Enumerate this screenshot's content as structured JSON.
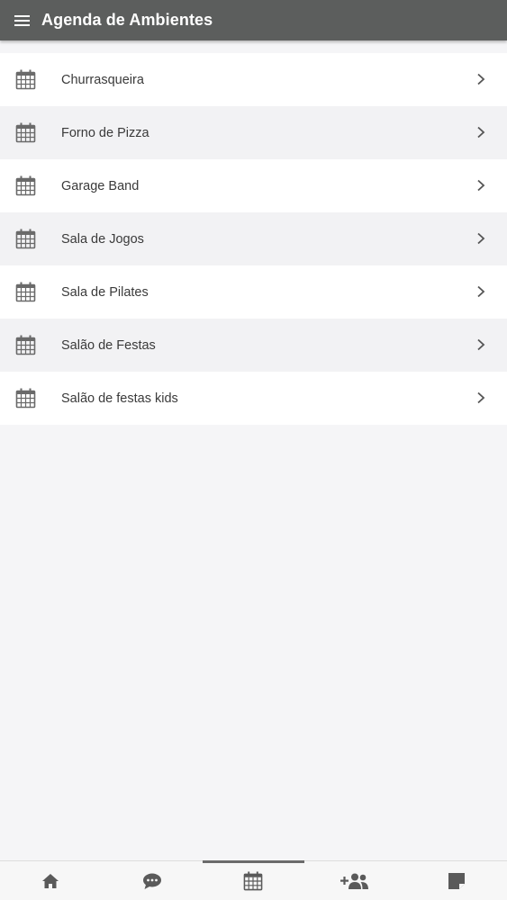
{
  "header": {
    "title": "Agenda de Ambientes",
    "menu_icon": "hamburger-menu-icon",
    "background": "#5c5e5d"
  },
  "list": {
    "item_icon": "calendar-icon",
    "trailing_icon": "chevron-right-icon",
    "items": [
      {
        "label": "Churrasqueira"
      },
      {
        "label": "Forno de Pizza"
      },
      {
        "label": "Garage Band"
      },
      {
        "label": "Sala de Jogos"
      },
      {
        "label": "Sala de Pilates"
      },
      {
        "label": "Salão de Festas"
      },
      {
        "label": "Salão de festas kids"
      }
    ]
  },
  "bottom_nav": {
    "active_index": 2,
    "tabs": [
      {
        "icon": "home-icon"
      },
      {
        "icon": "chat-bubble-icon"
      },
      {
        "icon": "calendar-icon"
      },
      {
        "icon": "add-person-icon"
      },
      {
        "icon": "note-icon"
      }
    ]
  }
}
